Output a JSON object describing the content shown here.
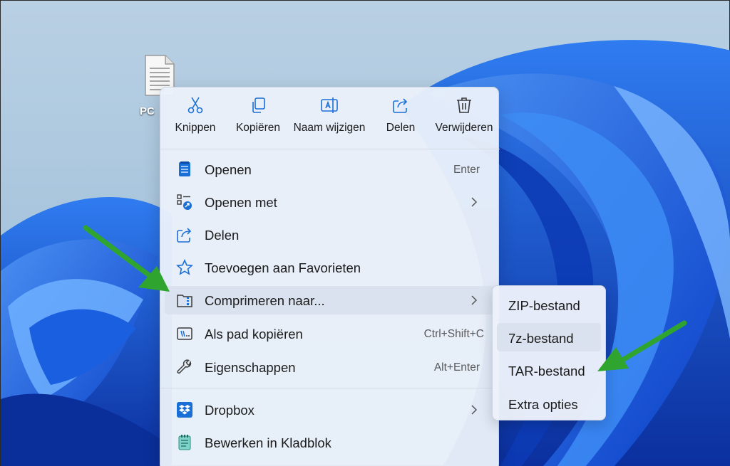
{
  "desktop": {
    "file_label": "PC"
  },
  "toolbar": {
    "cut": "Knippen",
    "copy": "Kopiëren",
    "rename": "Naam wijzigen",
    "share": "Delen",
    "delete": "Verwijderen"
  },
  "menu": {
    "open": {
      "label": "Openen",
      "shortcut": "Enter"
    },
    "open_with": {
      "label": "Openen met"
    },
    "share": {
      "label": "Delen"
    },
    "favorites": {
      "label": "Toevoegen aan Favorieten"
    },
    "compress": {
      "label": "Comprimeren naar..."
    },
    "copy_path": {
      "label": "Als pad kopiëren",
      "shortcut": "Ctrl+Shift+C"
    },
    "properties": {
      "label": "Eigenschappen",
      "shortcut": "Alt+Enter"
    },
    "dropbox": {
      "label": "Dropbox"
    },
    "notepad": {
      "label": "Bewerken in Kladblok"
    }
  },
  "submenu": {
    "zip": "ZIP-bestand",
    "sevenz": "7z-bestand",
    "tar": "TAR-bestand",
    "extra": "Extra opties"
  },
  "colors": {
    "accent_blue": "#1a6fd6",
    "arrow_green": "#2fa52f",
    "hover": "#d9e2ee"
  },
  "icons": {
    "cut": "scissors-icon",
    "copy": "copy-icon",
    "rename": "rename-icon",
    "share": "share-icon",
    "delete": "trash-icon",
    "open": "notepad-icon",
    "open_with": "open-with-icon",
    "favorites": "star-icon",
    "compress": "zip-folder-icon",
    "copy_path": "path-icon",
    "properties": "wrench-icon",
    "dropbox": "dropbox-icon",
    "notepad": "notepad-icon"
  }
}
